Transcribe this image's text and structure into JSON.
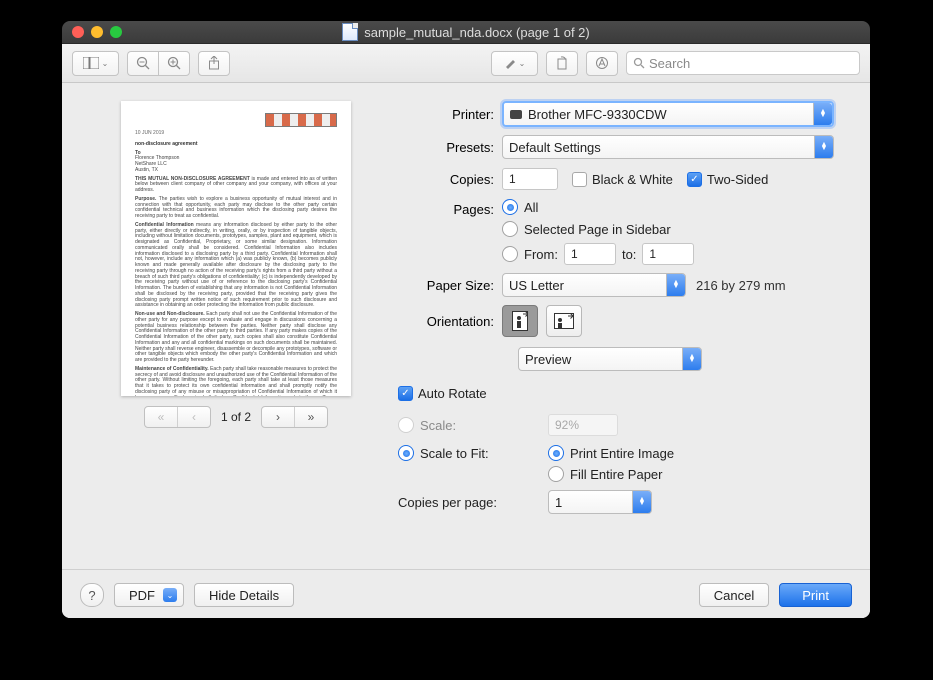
{
  "window_title": "sample_mutual_nda.docx (page 1 of 2)",
  "search_placeholder": "Search",
  "pager": {
    "label": "1 of 2"
  },
  "labels": {
    "printer": "Printer:",
    "presets": "Presets:",
    "copies": "Copies:",
    "black_white": "Black & White",
    "two_sided": "Two-Sided",
    "pages": "Pages:",
    "all": "All",
    "selected_page": "Selected Page in Sidebar",
    "from": "From:",
    "to": "to:",
    "paper_size": "Paper Size:",
    "orientation": "Orientation:",
    "section": "Preview",
    "auto_rotate": "Auto Rotate",
    "scale": "Scale:",
    "scale_to_fit": "Scale to Fit:",
    "print_entire": "Print Entire Image",
    "fill_paper": "Fill Entire Paper",
    "copies_per_page": "Copies per page:"
  },
  "values": {
    "printer": "Brother MFC-9330CDW",
    "preset": "Default Settings",
    "copies": "1",
    "from": "1",
    "to": "1",
    "paper_size": "US Letter",
    "paper_dim": "216 by 279 mm",
    "scale_pct": "92%",
    "copies_per_page": "1"
  },
  "footer": {
    "pdf": "PDF",
    "hide_details": "Hide Details",
    "cancel": "Cancel",
    "print": "Print"
  }
}
